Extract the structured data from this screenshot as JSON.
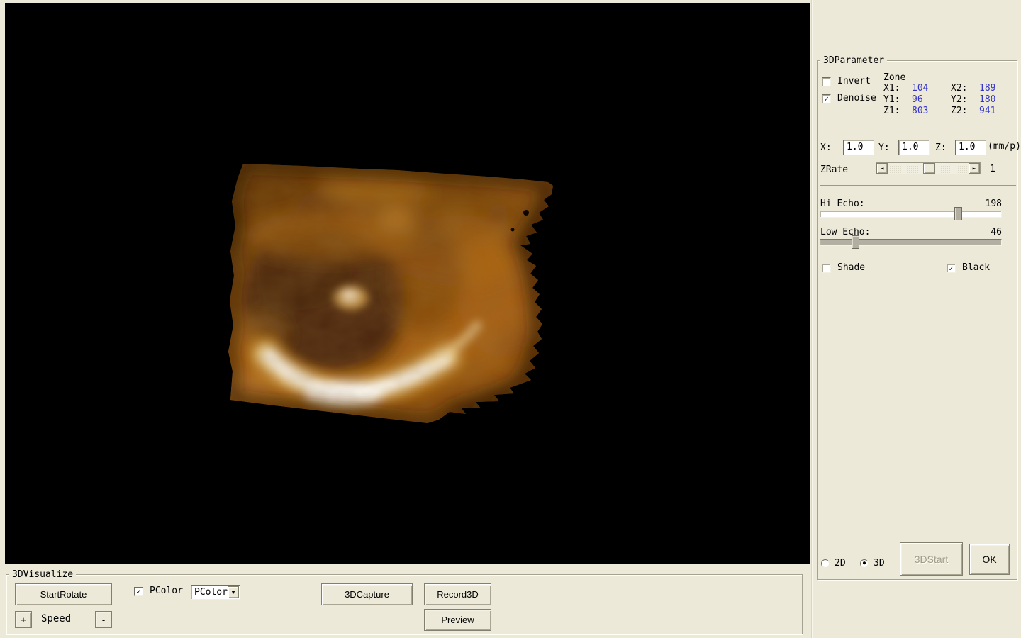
{
  "colors": {
    "panel_bg": "#ece9d8",
    "value_blue": "#3232c8",
    "viewport_bg": "#000000"
  },
  "parameter_panel": {
    "title": "3DParameter",
    "invert": {
      "label": "Invert",
      "check": ""
    },
    "denoise": {
      "label": "Denoise",
      "check": "✓"
    },
    "zone": {
      "title": "Zone",
      "rows": [
        {
          "l1": "X1:",
          "v1": "104",
          "l2": "X2:",
          "v2": "189"
        },
        {
          "l1": "Y1:",
          "v1": "96",
          "l2": "Y2:",
          "v2": "180"
        },
        {
          "l1": "Z1:",
          "v1": "803",
          "l2": "Z2:",
          "v2": "941"
        }
      ]
    },
    "scale": {
      "x_label": "X:",
      "x_value": "1.0",
      "y_label": "Y:",
      "y_value": "1.0",
      "z_label": "Z:",
      "z_value": "1.0",
      "unit": "(mm/p)"
    },
    "zrate": {
      "label": "ZRate",
      "value": "1",
      "left_arrow": "◄",
      "right_arrow": "►"
    },
    "hi_echo": {
      "label": "Hi Echo:",
      "value": 198,
      "max": 255
    },
    "low_echo": {
      "label": "Low Echo:",
      "value": 46,
      "max": 255
    },
    "shade": {
      "label": "Shade",
      "check": ""
    },
    "black": {
      "label": "Black",
      "check": "✓"
    },
    "mode_2d": {
      "label": "2D",
      "dot": ""
    },
    "mode_3d": {
      "label": "3D",
      "dot": "●"
    },
    "start_button": {
      "label": "3DStart",
      "enabled": false
    },
    "ok_button": {
      "label": "OK"
    }
  },
  "visualize_panel": {
    "title": "3DVisualize",
    "start_rotate_button": "StartRotate",
    "pcolor_checkbox": {
      "label": "PColor",
      "check": "✓"
    },
    "pcolor_dropdown": {
      "value": "PColor",
      "arrow": "▼"
    },
    "speed": {
      "plus": "+",
      "label": "Speed",
      "minus": "-"
    },
    "capture_button": "3DCapture",
    "record_button": "Record3D",
    "preview_button": "Preview"
  }
}
